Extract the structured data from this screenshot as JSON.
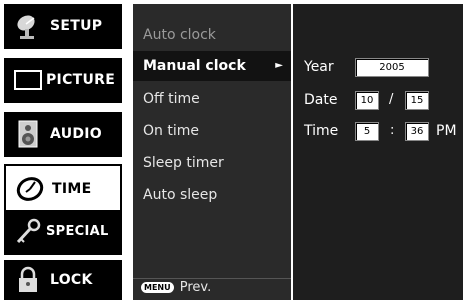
{
  "sidebar": {
    "items": [
      {
        "label": "SETUP",
        "icon": "satellite-dish-icon",
        "selected": false
      },
      {
        "label": "PICTURE",
        "icon": "monitor-icon",
        "selected": false
      },
      {
        "label": "AUDIO",
        "icon": "speaker-icon",
        "selected": false
      },
      {
        "label": "TIME",
        "icon": "clock-icon",
        "selected": true
      },
      {
        "label": "SPECIAL",
        "icon": "key-icon",
        "selected": false
      },
      {
        "label": "LOCK",
        "icon": "padlock-icon",
        "selected": false
      }
    ]
  },
  "submenu": {
    "items": [
      {
        "label": "Auto clock",
        "state": "dim"
      },
      {
        "label": "Manual clock",
        "state": "active"
      },
      {
        "label": "Off time",
        "state": "normal"
      },
      {
        "label": "On time",
        "state": "normal"
      },
      {
        "label": "Sleep timer",
        "state": "normal"
      },
      {
        "label": "Auto sleep",
        "state": "normal"
      }
    ],
    "arrow": "►",
    "footer": {
      "key": "MENU",
      "label": "Prev."
    }
  },
  "detail": {
    "year": {
      "label": "Year",
      "value": "2005"
    },
    "date": {
      "label": "Date",
      "month": "10",
      "separator": "/",
      "day": "15"
    },
    "time": {
      "label": "Time",
      "hour": "5",
      "separator": ":",
      "minute": "36",
      "ampm": "PM"
    }
  }
}
